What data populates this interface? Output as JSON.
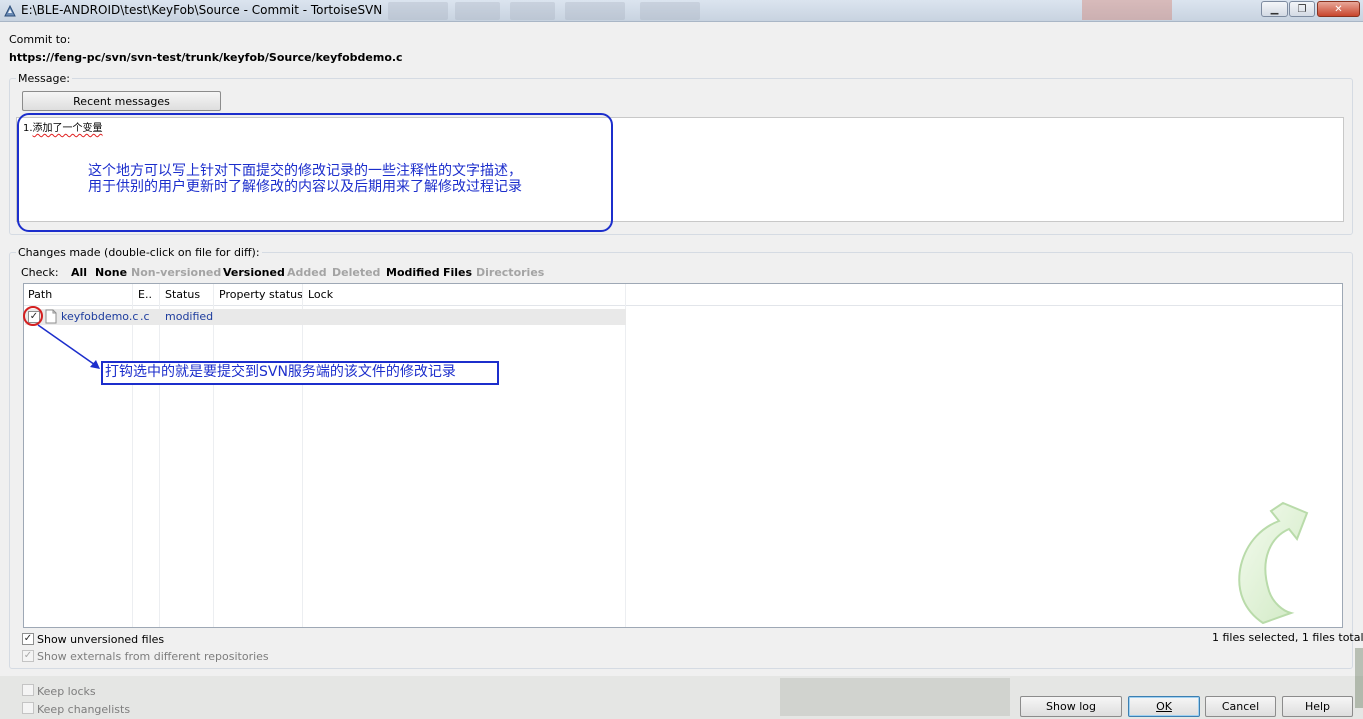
{
  "window": {
    "title": "E:\\BLE-ANDROID\\test\\KeyFob\\Source - Commit - TortoiseSVN",
    "minimize_glyph": "▁",
    "maximize_glyph": "❐",
    "close_glyph": "✕"
  },
  "commit": {
    "label": "Commit to:",
    "url": "https://feng-pc/svn/svn-test/trunk/keyfob/Source/keyfobdemo.c"
  },
  "message": {
    "group_label": "Message:",
    "recent_button": "Recent messages",
    "line_number": "1.",
    "text": "添加了一个变量"
  },
  "annotation1": {
    "line1": "这个地方可以写上针对下面提交的修改记录的一些注释性的文字描述，",
    "line2": "用于供别的用户更新时了解修改的内容以及后期用来了解修改过程记录"
  },
  "changes": {
    "group_label": "Changes made (double-click on file for diff):",
    "check_label": "Check:",
    "filters": [
      {
        "label": "All",
        "enabled": true
      },
      {
        "label": "None",
        "enabled": true
      },
      {
        "label": "Non-versioned",
        "enabled": false
      },
      {
        "label": "Versioned",
        "enabled": true
      },
      {
        "label": "Added",
        "enabled": false
      },
      {
        "label": "Deleted",
        "enabled": false
      },
      {
        "label": "Modified",
        "enabled": true
      },
      {
        "label": "Files",
        "enabled": true
      },
      {
        "label": "Directories",
        "enabled": false
      }
    ],
    "columns": [
      "Path",
      "E..",
      "Status",
      "Property status",
      "Lock"
    ],
    "rows": [
      {
        "checked": true,
        "path": "keyfobdemo.c",
        "ext": ".c",
        "status": "modified",
        "property_status": "",
        "lock": ""
      }
    ],
    "check_glyph": "✓"
  },
  "annotation2": {
    "text": "打钩选中的就是要提交到SVN服务端的该文件的修改记录"
  },
  "options": {
    "show_unversioned": "Show unversioned files",
    "show_externals": "Show externals from different repositories",
    "keep_locks": "Keep locks",
    "keep_changelists": "Keep changelists",
    "selection_summary": "1 files selected, 1 files total"
  },
  "buttons": {
    "show_log": "Show log",
    "ok": "OK",
    "cancel": "Cancel",
    "help": "Help"
  },
  "colors": {
    "annotation": "#1c2ecc",
    "file_text": "#1d3c9e",
    "disabled_filter": "#a4a4a4"
  }
}
